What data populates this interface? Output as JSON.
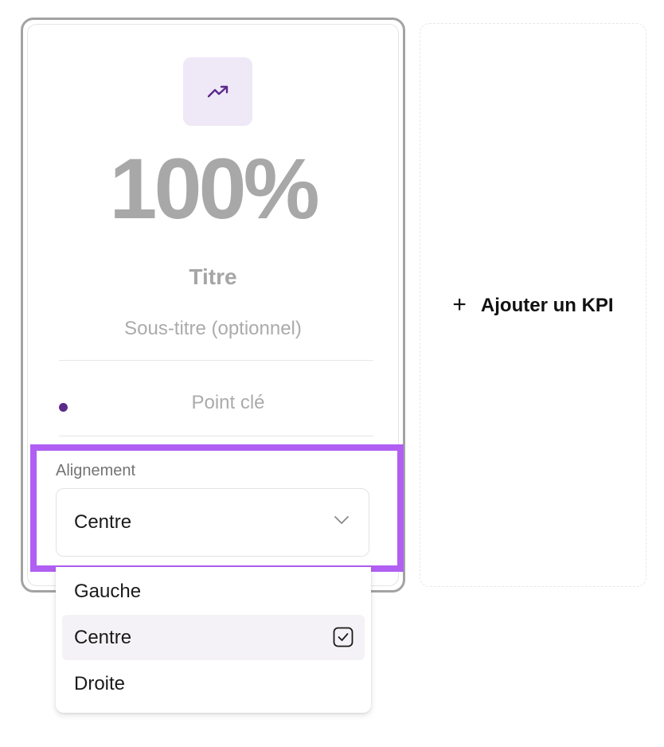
{
  "kpi_card": {
    "value": "100%",
    "title": "Titre",
    "subtitle_placeholder": "Sous-titre (optionnel)",
    "key_point_placeholder": "Point clé",
    "icon": "trending-up-icon",
    "colors": {
      "accent": "#5b2a8a",
      "icon_tile_bg": "#efe8f7",
      "highlight_border": "#b05ff2"
    }
  },
  "alignment": {
    "label": "Alignement",
    "selected": "Centre",
    "options": [
      "Gauche",
      "Centre",
      "Droite"
    ]
  },
  "add_kpi": {
    "label": "Ajouter un KPI",
    "icon": "plus-icon"
  }
}
